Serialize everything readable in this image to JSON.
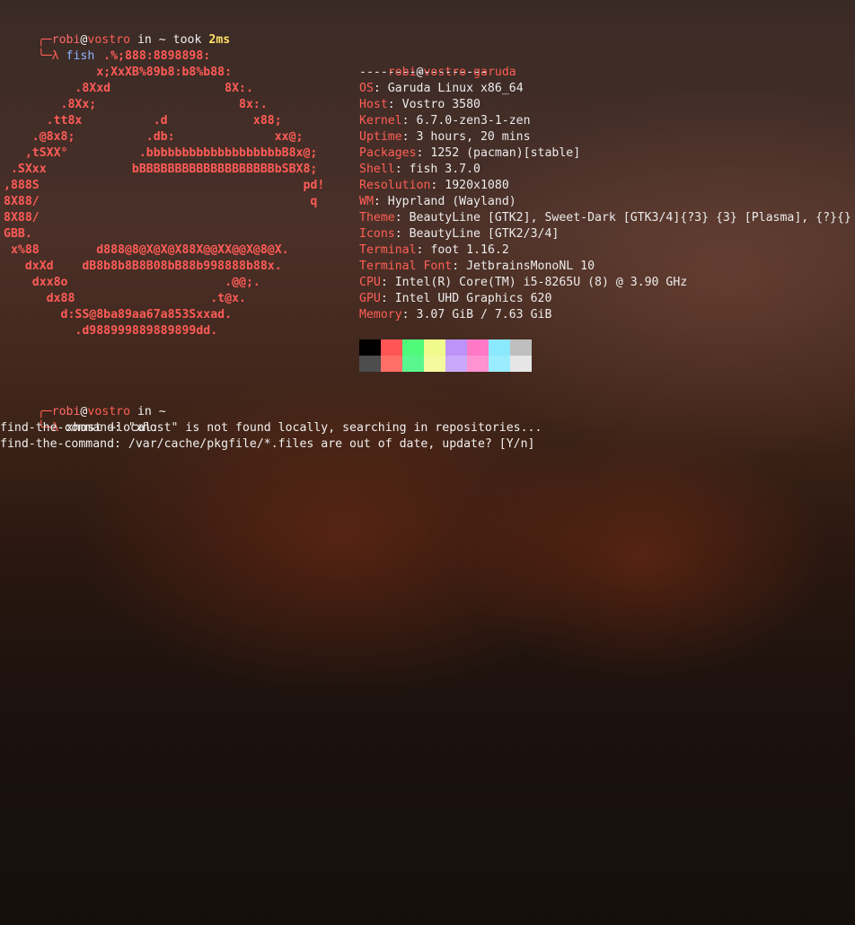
{
  "prompt1": {
    "user": "robi",
    "at": "@",
    "host": "vostro",
    "in_label": " in ",
    "dir": "~",
    "took_label": " took ",
    "duration": "2ms",
    "command": "fish"
  },
  "logo_lines": [
    "              .%;888:8898898:",
    "             x;XxXB%89b8:b8%b88:",
    "          .8Xxd                8X:.",
    "        .8Xx;                    8x:.",
    "      .tt8x          .d            x88;",
    "    .@8x8;          .db:              xx@;",
    "   ,tSXX°          .bbbbbbbbbbbbbbbbbbbB8x@;",
    " .SXxx            bBBBBBBBBBBBBBBBBBBBbSBX8;",
    ",888S                                     pd!",
    "8X88/                                      q",
    "8X88/",
    "GBB.",
    " x%88        d888@8@X@X@X88X@@XX@@X@8@X.",
    "   dxXd    dB8b8b8B8B08bB88b998888b88x.",
    "    dxx8o                      .@@;.",
    "      dx88                   .t@x.",
    "        d:SS@8ba89aa67a853Sxxad.",
    "          .d988999889889899dd."
  ],
  "info_title": {
    "user": "robi",
    "at": "@",
    "host": "vostro-garuda",
    "separator": "------------------"
  },
  "info": [
    {
      "key": "OS",
      "value": "Garuda Linux x86_64"
    },
    {
      "key": "Host",
      "value": "Vostro 3580"
    },
    {
      "key": "Kernel",
      "value": "6.7.0-zen3-1-zen"
    },
    {
      "key": "Uptime",
      "value": "3 hours, 20 mins"
    },
    {
      "key": "Packages",
      "value": "1252 (pacman)[stable]"
    },
    {
      "key": "Shell",
      "value": "fish 3.7.0"
    },
    {
      "key": "Resolution",
      "value": "1920x1080"
    },
    {
      "key": "WM",
      "value": "Hyprland (Wayland)"
    },
    {
      "key": "Theme",
      "value": "BeautyLine [GTK2], Sweet-Dark [GTK3/4]{?3} {3} [Plasma], {?}{}"
    },
    {
      "key": "Icons",
      "value": "BeautyLine [GTK2/3/4]"
    },
    {
      "key": "Terminal",
      "value": "foot 1.16.2"
    },
    {
      "key": "Terminal Font",
      "value": "JetbrainsMonoNL 10"
    },
    {
      "key": "CPU",
      "value": "Intel(R) Core(TM) i5-8265U (8) @ 3.90 GHz"
    },
    {
      "key": "GPU",
      "value": "Intel UHD Graphics 620"
    },
    {
      "key": "Memory",
      "value": "3.07 GiB / 7.63 GiB"
    }
  ],
  "palette_top": [
    "#000000",
    "#ff5555",
    "#50fa7b",
    "#f1fa8c",
    "#bd93f9",
    "#ff79c6",
    "#8be9fd",
    "#bfbfbf"
  ],
  "palette_bottom": [
    "#4d4d4d",
    "#ff6e67",
    "#5af78e",
    "#f4f99d",
    "#caa9fa",
    "#ff92d0",
    "#9aedfe",
    "#e6e6e6"
  ],
  "prompt2": {
    "user": "robi",
    "at": "@",
    "host": "vostro",
    "in_label": " in ",
    "dir": "~",
    "command": "xhost +local:"
  },
  "output": [
    "find-the-command: \"xhost\" is not found locally, searching in repositories...",
    "find-the-command: /var/cache/pkgfile/*.files are out of date, update? [Y/n]"
  ],
  "prompt_glyphs": {
    "corner_top": "╭─",
    "corner_bottom": "╰─",
    "lambda": "λ "
  }
}
